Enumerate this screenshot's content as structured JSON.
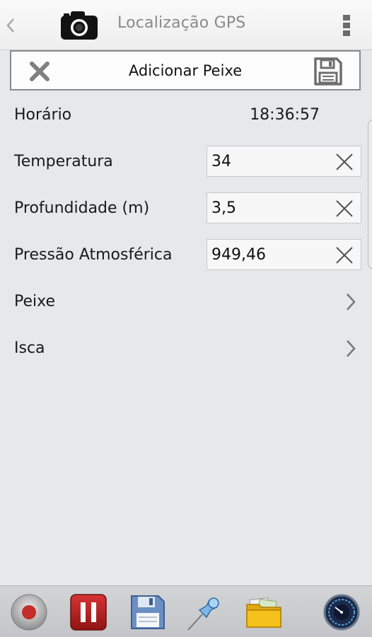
{
  "appbar": {
    "title": "Localização GPS",
    "icons": [
      "back-chevron-icon",
      "camera-icon",
      "overflow-menu-icon"
    ]
  },
  "dialog": {
    "title": "Adicionar Peixe",
    "icons": [
      "close-icon",
      "floppy-save-icon"
    ]
  },
  "form": {
    "time": {
      "label": "Horário",
      "value": "18:36:57"
    },
    "temperature": {
      "label": "Temperatura",
      "value": "34"
    },
    "depth": {
      "label": "Profundidade (m)",
      "value": "3,5"
    },
    "pressure": {
      "label": "Pressão Atmosférica",
      "value": "949,46"
    },
    "fish": {
      "label": "Peixe"
    },
    "bait": {
      "label": "Isca"
    }
  },
  "toolbar": {
    "icons": [
      "record-icon",
      "pause-icon",
      "floppy-save-icon",
      "pushpin-icon",
      "folder-icon",
      "speedometer-icon"
    ]
  },
  "colors": {
    "background": "#e6e8ea",
    "pause_red": "#b51b1b",
    "record_red": "#c42b2b",
    "folder_yellow": "#f5c21b",
    "save_blue": "#6b8fc2"
  }
}
